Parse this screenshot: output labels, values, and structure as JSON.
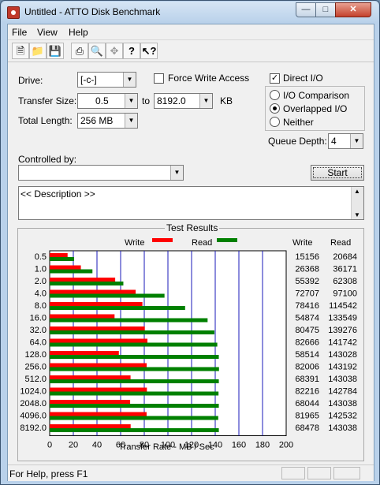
{
  "window": {
    "title": "Untitled - ATTO Disk Benchmark"
  },
  "menu": {
    "file": "File",
    "view": "View",
    "help": "Help"
  },
  "toolbar": {
    "icons": [
      "new-file-icon",
      "open-folder-icon",
      "save-icon",
      "print-icon",
      "print-preview-icon",
      "move-icon",
      "help-icon",
      "context-help-icon"
    ]
  },
  "form": {
    "drive_label": "Drive:",
    "drive_value": "[-c-]",
    "force_write_label": "Force Write Access",
    "force_write_checked": false,
    "direct_io_label": "Direct I/O",
    "direct_io_checked": true,
    "transfer_size_label": "Transfer Size:",
    "transfer_from": "0.5",
    "to_label": "to",
    "transfer_to": "8192.0",
    "kb_label": "KB",
    "total_length_label": "Total Length:",
    "total_length_value": "256 MB",
    "io_comparison_label": "I/O Comparison",
    "overlapped_io_label": "Overlapped I/O",
    "neither_label": "Neither",
    "selected_mode": "Overlapped I/O",
    "queue_depth_label": "Queue Depth:",
    "queue_depth_value": "4",
    "controlled_by_label": "Controlled by:",
    "controlled_by_value": "",
    "start_label": "Start",
    "description_text": "<< Description >>"
  },
  "results": {
    "title": "Test Results",
    "legend_write": "Write",
    "legend_read": "Read",
    "col_write": "Write",
    "col_read": "Read"
  },
  "chart_data": {
    "type": "bar",
    "categories": [
      "0.5",
      "1.0",
      "2.0",
      "4.0",
      "8.0",
      "16.0",
      "32.0",
      "64.0",
      "128.0",
      "256.0",
      "512.0",
      "1024.0",
      "2048.0",
      "4096.0",
      "8192.0"
    ],
    "series": [
      {
        "name": "Write",
        "color": "#ff0000",
        "values": [
          15156,
          26368,
          55392,
          72707,
          78416,
          54874,
          80475,
          82666,
          58514,
          82006,
          68391,
          82216,
          68044,
          81965,
          68478
        ]
      },
      {
        "name": "Read",
        "color": "#008000",
        "values": [
          20684,
          36171,
          62308,
          97100,
          114542,
          133549,
          139276,
          141742,
          143028,
          143192,
          143038,
          142784,
          143038,
          142532,
          143038
        ]
      }
    ],
    "xlabel": "Transfer Rate - MB / Sec",
    "xlim": [
      0,
      200
    ],
    "xticks": [
      "0",
      "20",
      "40",
      "60",
      "80",
      "100",
      "120",
      "140",
      "160",
      "180",
      "200"
    ],
    "grid": true,
    "legend": "top"
  },
  "status": {
    "text": "For Help, press F1"
  }
}
